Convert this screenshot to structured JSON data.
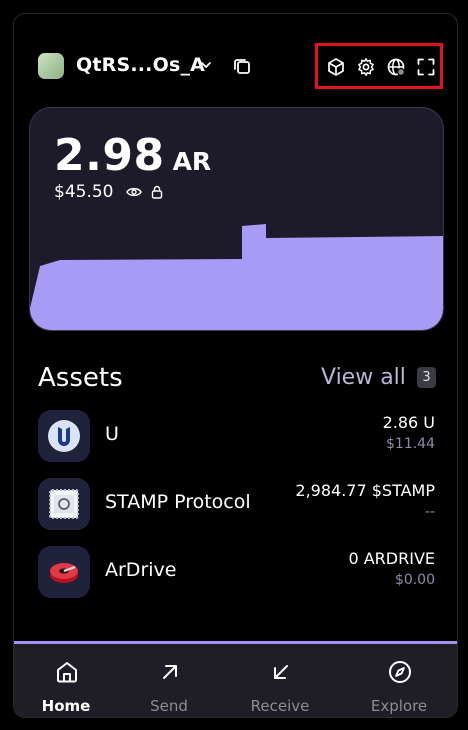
{
  "header": {
    "wallet_name": "QtRS...Os_A",
    "icons": [
      "cube-icon",
      "gear-icon",
      "globe-icon",
      "fullscreen-icon"
    ]
  },
  "balance": {
    "amount": "2.98",
    "unit": "AR",
    "fiat": "$45.50"
  },
  "assets": {
    "title": "Assets",
    "view_all": "View all",
    "count": "3",
    "items": [
      {
        "name": "U",
        "balance": "2.86 U",
        "fiat": "$11.44"
      },
      {
        "name": "STAMP Protocol",
        "balance": "2,984.77 $STAMP",
        "fiat": "--"
      },
      {
        "name": "ArDrive",
        "balance": "0 ARDRIVE",
        "fiat": "$0.00"
      }
    ]
  },
  "nav": {
    "items": [
      {
        "label": "Home",
        "icon": "home-icon"
      },
      {
        "label": "Send",
        "icon": "arrow-up-right-icon"
      },
      {
        "label": "Receive",
        "icon": "arrow-down-left-icon"
      },
      {
        "label": "Explore",
        "icon": "compass-icon"
      }
    ]
  },
  "colors": {
    "accent": "#a79bf5",
    "card_bg": "#1d1a2a",
    "nav_bg": "#1f1e26",
    "highlight_border": "#e0141a"
  }
}
